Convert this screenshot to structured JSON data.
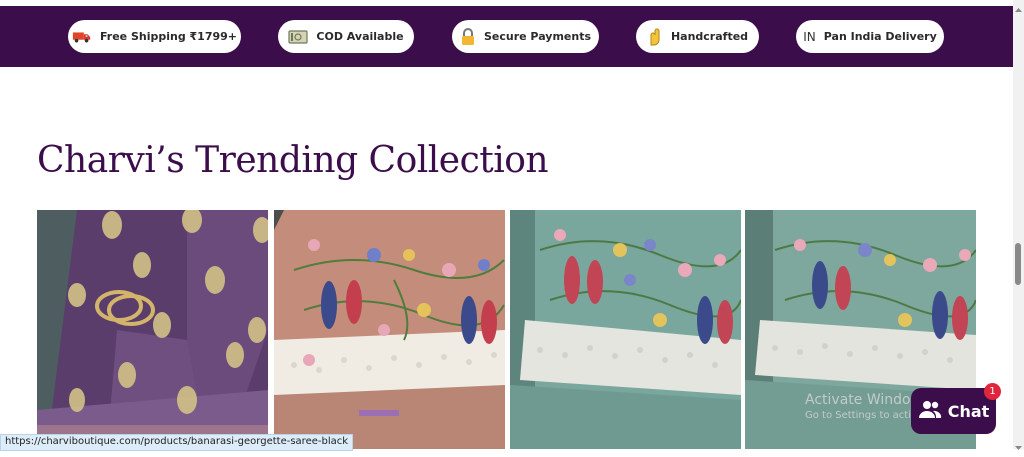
{
  "banner": {
    "items": [
      {
        "label": "Free Shipping ₹1799+",
        "icon": "truck-icon"
      },
      {
        "label": "COD Available",
        "icon": "cash-icon"
      },
      {
        "label": "Secure Payments",
        "icon": "lock-icon"
      },
      {
        "label": "Handcrafted",
        "icon": "hand-icon"
      },
      {
        "label": "Pan India Delivery",
        "icon": "india-flag-icon",
        "icon_text": "IN"
      }
    ]
  },
  "section": {
    "title": "Charvi’s Trending Collection"
  },
  "products": [
    {
      "name": "purple-saree",
      "colors": [
        "#5e3a6e",
        "#c8b06a"
      ]
    },
    {
      "name": "peach-embroidered-saree",
      "colors": [
        "#c78e7c",
        "#f1ece2"
      ]
    },
    {
      "name": "sea-green-embroidered-saree",
      "colors": [
        "#79a79f",
        "#e6e6e0"
      ]
    },
    {
      "name": "sea-green-embroidered-saree-2",
      "colors": [
        "#7fa89e",
        "#e3e4de"
      ]
    }
  ],
  "status_bar": {
    "url": "https://charviboutique.com/products/banarasi-georgette-saree-black"
  },
  "windows_watermark": {
    "line1": "Activate Windows",
    "line2": "Go to Settings to activate Windows."
  },
  "chat": {
    "label": "Chat",
    "badge": "1"
  },
  "colors": {
    "brand": "#3b0d4a",
    "badge": "#e0263c"
  }
}
